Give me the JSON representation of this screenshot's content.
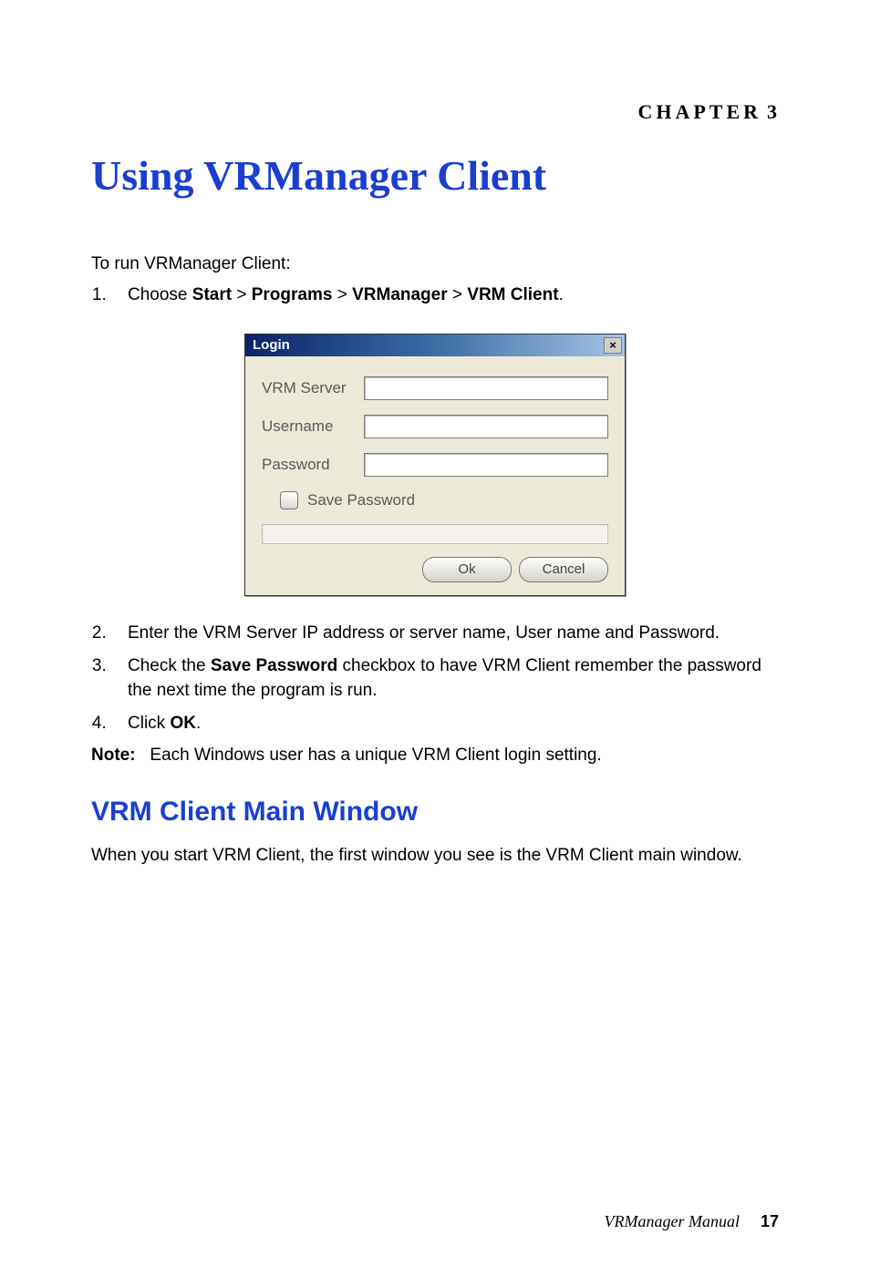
{
  "chapter": {
    "label": "CHAPTER",
    "number": "3"
  },
  "title": "Using VRManager Client",
  "intro": "To run VRManager Client:",
  "step1": {
    "prefix": "Choose ",
    "start": "Start",
    "sep": " > ",
    "programs": "Programs",
    "vrm": "VRManager",
    "client": "VRM Client",
    "suffix": "."
  },
  "dialog": {
    "title": "Login",
    "close": "×",
    "vrm_server_label": "VRM Server",
    "username_label": "Username",
    "password_label": "Password",
    "save_password_label": "Save Password",
    "ok_label": "Ok",
    "cancel_label": "Cancel"
  },
  "step2": "Enter the VRM Server IP address or server name, User name and Password.",
  "step3": {
    "prefix": "Check the ",
    "bold": "Save Password",
    "suffix": " checkbox to have VRM Client remember the password the next time the program is run."
  },
  "step4": {
    "prefix": "Click ",
    "bold": "OK",
    "suffix": "."
  },
  "note": {
    "label": "Note:",
    "text": "Each Windows user has a unique VRM Client login setting."
  },
  "subhead": "VRM Client Main Window",
  "body2": "When you start VRM Client, the first window you see is the VRM Client main window.",
  "footer": {
    "book": "VRManager Manual",
    "page": "17"
  }
}
